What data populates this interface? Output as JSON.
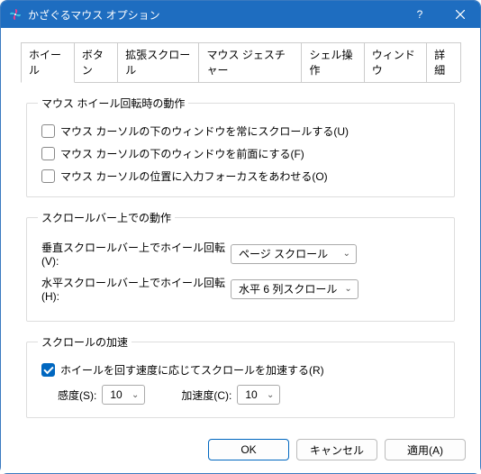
{
  "window": {
    "title": "かざぐるマウス オプション"
  },
  "tabs": {
    "t0": "ホイール",
    "t1": "ボタン",
    "t2": "拡張スクロール",
    "t3": "マウス ジェスチャー",
    "t4": "シェル操作",
    "t5": "ウィンドウ",
    "t6": "詳細"
  },
  "group_wheel_rotation": {
    "legend": "マウス ホイール回転時の動作",
    "cb1": "マウス カーソルの下のウィンドウを常にスクロールする(U)",
    "cb2": "マウス カーソルの下のウィンドウを前面にする(F)",
    "cb3": "マウス カーソルの位置に入力フォーカスをあわせる(O)"
  },
  "group_scrollbar": {
    "legend": "スクロールバー上での動作",
    "row1_label": "垂直スクロールバー上でホイール回転(V):",
    "row1_value": "ページ スクロール",
    "row2_label": "水平スクロールバー上でホイール回転(H):",
    "row2_value": "水平 6 列スクロール"
  },
  "group_accel": {
    "legend": "スクロールの加速",
    "cb": "ホイールを回す速度に応じてスクロールを加速する(R)",
    "sens_label": "感度(S):",
    "sens_value": "10",
    "accel_label": "加速度(C):",
    "accel_value": "10"
  },
  "footer": {
    "ok": "OK",
    "cancel": "キャンセル",
    "apply": "適用(A)"
  }
}
